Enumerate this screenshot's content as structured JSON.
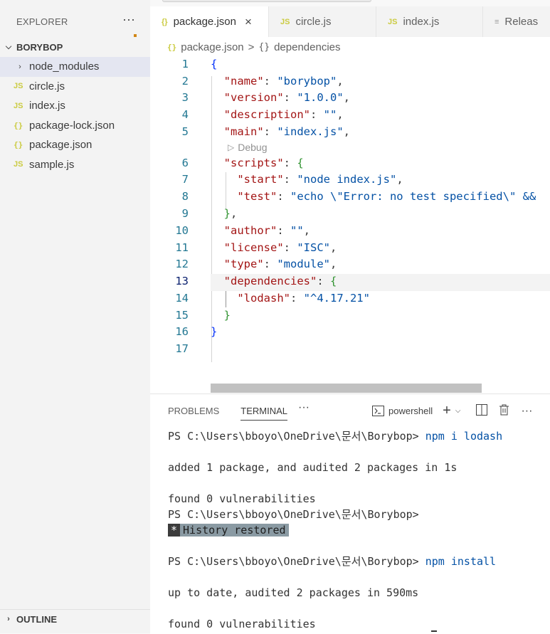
{
  "sidebar": {
    "title": "EXPLORER",
    "more": "···",
    "folder": "BORYBOP",
    "items": [
      {
        "icon": "",
        "label": "node_modules",
        "type": "folder"
      },
      {
        "icon": "JS",
        "label": "circle.js",
        "type": "js"
      },
      {
        "icon": "JS",
        "label": "index.js",
        "type": "js"
      },
      {
        "icon": "{}",
        "label": "package-lock.json",
        "type": "json"
      },
      {
        "icon": "{}",
        "label": "package.json",
        "type": "json"
      },
      {
        "icon": "JS",
        "label": "sample.js",
        "type": "js"
      }
    ],
    "outline": "OUTLINE"
  },
  "tabs": [
    {
      "icon": "{}",
      "label": "package.json",
      "close": "×"
    },
    {
      "icon": "JS",
      "label": "circle.js"
    },
    {
      "icon": "JS",
      "label": "index.js"
    },
    {
      "icon": "≡",
      "label": "Releas"
    }
  ],
  "editor": {
    "breadcrumb": {
      "file_icon": "{}",
      "file": "package.json",
      "sep": ">",
      "symbol_icon": "{}",
      "symbol": "dependencies"
    },
    "codelens": "Debug",
    "line_numbers": [
      "1",
      "2",
      "3",
      "4",
      "5",
      "6",
      "7",
      "8",
      "9",
      "10",
      "11",
      "12",
      "13",
      "14",
      "15",
      "16",
      "17"
    ],
    "code": {
      "name_key": "\"name\"",
      "name_val": "\"borybop\"",
      "version_key": "\"version\"",
      "version_val": "\"1.0.0\"",
      "desc_key": "\"description\"",
      "desc_val": "\"\"",
      "main_key": "\"main\"",
      "main_val": "\"index.js\"",
      "scripts_key": "\"scripts\"",
      "start_key": "\"start\"",
      "start_val": "\"node index.js\"",
      "test_key": "\"test\"",
      "test_val": "\"echo \\\"Error: no test specified\\\" &&",
      "author_key": "\"author\"",
      "author_val": "\"\"",
      "license_key": "\"license\"",
      "license_val": "\"ISC\"",
      "type_key": "\"type\"",
      "type_val": "\"module\"",
      "deps_key": "\"dependencies\"",
      "lodash_key": "\"lodash\"",
      "lodash_val": "\"^4.17.21\""
    }
  },
  "panel": {
    "tabs": [
      "PROBLEMS",
      "TERMINAL"
    ],
    "more": "···",
    "shell": "powershell",
    "terminal": {
      "prompt": "PS C:\\Users\\bboyo\\OneDrive\\문서\\Borybop>",
      "cmd1": "npm i lodash",
      "out1": "added 1 package, and audited 2 packages in 1s",
      "out2": "found 0 vulnerabilities",
      "history_marker": "*",
      "history": "History restored",
      "cmd2": "npm install",
      "out3": "up to date, audited 2 packages in 590ms",
      "out4": "found 0 vulnerabilities"
    }
  }
}
